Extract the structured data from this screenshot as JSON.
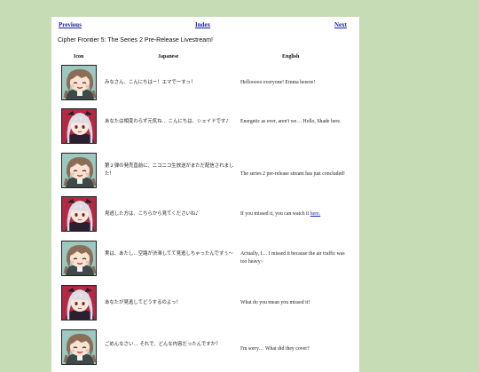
{
  "nav": {
    "previous": "Previous",
    "index": "Index",
    "next": "Next"
  },
  "page_title": "Cipher Frontier 5: The Series 2 Pre-Release Livestream!",
  "columns": {
    "icon": "Icon",
    "japanese": "Japanese",
    "english": "English"
  },
  "rows": [
    {
      "character": "emma",
      "jp": "みなさん、こんにちはー！エマでーすっ！",
      "en": "Hellooooo everyone! Emma heeere!"
    },
    {
      "character": "shade",
      "jp": "あなたは相変わらず元気ね… こんにちは、シェイドです♪",
      "en": "Energetic as ever, aren't we… Hello, Shade here."
    },
    {
      "character": "emma",
      "jp": "第２弾の発売直前に、ニコニコ生放送がまただ配信されました！",
      "en": "The series 2 pre-release stream has just concluded!"
    },
    {
      "character": "shade",
      "jp": "見逃した方は、こちらから見てくださいね♪",
      "en": "If you missed it, you can watch it ",
      "link": "here."
    },
    {
      "character": "emma",
      "jp": "実は、あたし…空路が渋滞してて見逃しちゃったんですぅ～",
      "en": "Actually, I… I missed it because the air traffic was too heavy~"
    },
    {
      "character": "shade",
      "jp": "あなたが見逃してどうするのよっ！",
      "en": "What do you mean you missed it!"
    },
    {
      "character": "emma",
      "jp": "ごめんなさい… それで、どんな内容だったんですか？",
      "en": "I'm sorry… What did they cover?"
    }
  ],
  "colors": {
    "background": "#c6dcb4",
    "link": "#1a1aa8",
    "emma_hair": "#8c6e58",
    "emma_bg": "#9cc8c0",
    "shade_hair": "#dcdae4",
    "shade_bg": "#b02a44"
  }
}
